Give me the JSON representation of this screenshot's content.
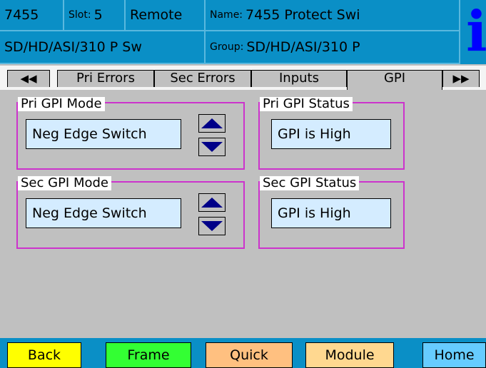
{
  "header": {
    "id": "7455",
    "slot_label": "Slot:",
    "slot_value": "5",
    "mode": "Remote",
    "name_label": "Name:",
    "name_value": "7455 Protect Swi",
    "model": "SD/HD/ASI/310 P Sw",
    "group_label": "Group:",
    "group_value": "SD/HD/ASI/310 P",
    "info_glyph": "i"
  },
  "tabs": {
    "prev_arrow": "◀◀",
    "next_arrow": "▶▶",
    "items": [
      {
        "label": "Pri Errors"
      },
      {
        "label": "Sec Errors"
      },
      {
        "label": "Inputs"
      },
      {
        "label": "GPI"
      }
    ],
    "active": "GPI"
  },
  "groups": {
    "pri_mode": {
      "title": "Pri GPI Mode",
      "value": "Neg Edge Switch"
    },
    "pri_status": {
      "title": "Pri GPI Status",
      "value": "GPI is High"
    },
    "sec_mode": {
      "title": "Sec GPI Mode",
      "value": "Neg Edge Switch"
    },
    "sec_status": {
      "title": "Sec GPI Status",
      "value": "GPI is High"
    }
  },
  "nav": {
    "back": "Back",
    "frame": "Frame",
    "quick": "Quick",
    "module": "Module",
    "home": "Home"
  },
  "colors": {
    "header_blue": "#0a8fc6",
    "back": "#ffff00",
    "frame": "#33ff33",
    "quick": "#ffc080",
    "module": "#ffd890",
    "home": "#66ccff",
    "group_border": "#cc33cc",
    "value_bg": "#d4ecff"
  }
}
